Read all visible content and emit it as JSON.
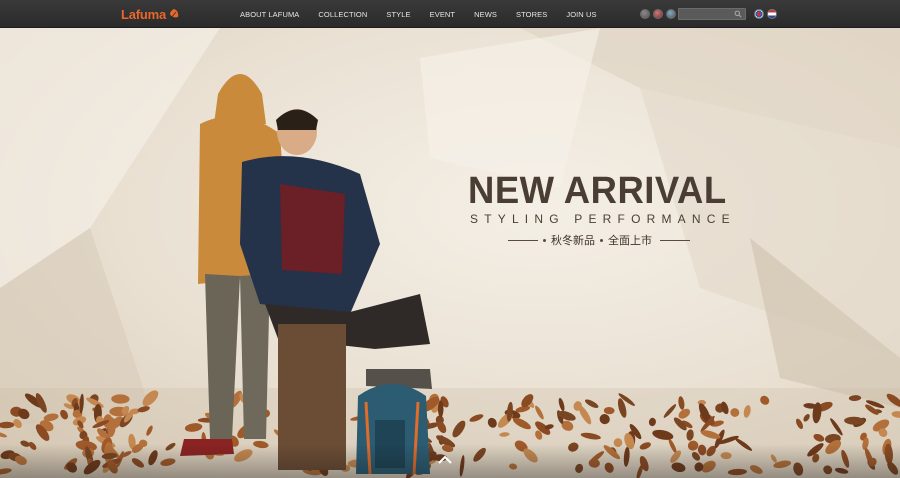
{
  "brand": {
    "logo_text": "Lafuma",
    "logo_icon": "leaf-icon",
    "accent": "#e8682a"
  },
  "nav": {
    "items": [
      {
        "label": "ABOUT LAFUMA"
      },
      {
        "label": "COLLECTION"
      },
      {
        "label": "STYLE"
      },
      {
        "label": "EVENT"
      },
      {
        "label": "NEWS"
      },
      {
        "label": "STORES"
      },
      {
        "label": "JOIN US"
      }
    ]
  },
  "social": [
    "social-icon-1",
    "social-icon-2",
    "social-icon-3"
  ],
  "search": {
    "value": "",
    "placeholder": ""
  },
  "languages": [
    "korea-flag-icon",
    "english-flag-icon"
  ],
  "hero": {
    "headline": "NEW ARRIVAL",
    "subline": "STYLING PERFORMANCE",
    "cn_left": "秋冬新品",
    "cn_right": "全面上市",
    "text_color": "#4a3e34"
  },
  "scroll_up_icon": "chevron-up-icon"
}
